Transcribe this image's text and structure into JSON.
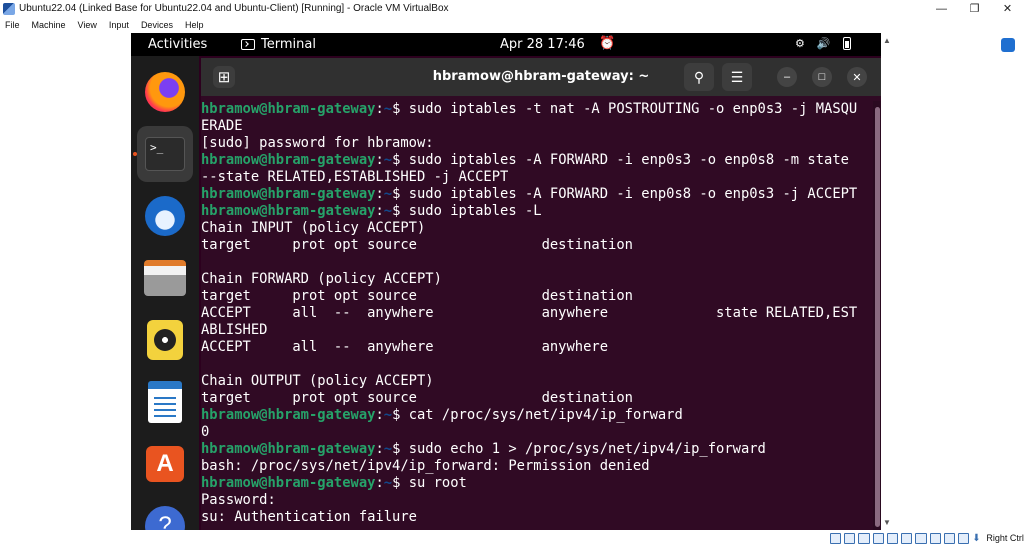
{
  "host": {
    "title": "Ubuntu22.04 (Linked Base for Ubuntu22.04 and Ubuntu-Client) [Running] - Oracle VM VirtualBox",
    "menu": [
      "File",
      "Machine",
      "View",
      "Input",
      "Devices",
      "Help"
    ],
    "window_buttons": [
      "minimize",
      "restore",
      "close"
    ],
    "status_right_label": "Right Ctrl"
  },
  "gnome": {
    "activities": "Activities",
    "app_name": "Terminal",
    "clock": "Apr 28  17:46"
  },
  "dock": {
    "apps": [
      {
        "name": "firefox-icon"
      },
      {
        "name": "terminal-icon",
        "glyph": ">_"
      },
      {
        "name": "thunderbird-icon"
      },
      {
        "name": "files-icon"
      },
      {
        "name": "rhythmbox-icon"
      },
      {
        "name": "libreoffice-writer-icon"
      },
      {
        "name": "app-center-icon",
        "glyph": "A"
      },
      {
        "name": "help-icon",
        "glyph": "?"
      }
    ]
  },
  "terminal": {
    "title": "hbramow@hbram-gateway: ~",
    "prompt_user": "hbramow@hbram-gateway",
    "prompt_sep": ":",
    "prompt_path": "~",
    "prompt_end": "$ ",
    "lines": [
      {
        "prompt": true,
        "text": "sudo iptables -t nat -A POSTROUTING -o enp0s3 -j MASQU"
      },
      {
        "prompt": false,
        "text": "ERADE"
      },
      {
        "prompt": false,
        "text": "[sudo] password for hbramow:"
      },
      {
        "prompt": true,
        "text": "sudo iptables -A FORWARD -i enp0s3 -o enp0s8 -m state"
      },
      {
        "prompt": false,
        "text": "--state RELATED,ESTABLISHED -j ACCEPT"
      },
      {
        "prompt": true,
        "text": "sudo iptables -A FORWARD -i enp0s8 -o enp0s3 -j ACCEPT"
      },
      {
        "prompt": true,
        "text": "sudo iptables -L"
      },
      {
        "prompt": false,
        "text": "Chain INPUT (policy ACCEPT)"
      },
      {
        "prompt": false,
        "text": "target     prot opt source               destination"
      },
      {
        "prompt": false,
        "text": ""
      },
      {
        "prompt": false,
        "text": "Chain FORWARD (policy ACCEPT)"
      },
      {
        "prompt": false,
        "text": "target     prot opt source               destination"
      },
      {
        "prompt": false,
        "text": "ACCEPT     all  --  anywhere             anywhere             state RELATED,EST"
      },
      {
        "prompt": false,
        "text": "ABLISHED"
      },
      {
        "prompt": false,
        "text": "ACCEPT     all  --  anywhere             anywhere"
      },
      {
        "prompt": false,
        "text": ""
      },
      {
        "prompt": false,
        "text": "Chain OUTPUT (policy ACCEPT)"
      },
      {
        "prompt": false,
        "text": "target     prot opt source               destination"
      },
      {
        "prompt": true,
        "text": "cat /proc/sys/net/ipv4/ip_forward"
      },
      {
        "prompt": false,
        "text": "0"
      },
      {
        "prompt": true,
        "text": "sudo echo 1 > /proc/sys/net/ipv4/ip_forward"
      },
      {
        "prompt": false,
        "text": "bash: /proc/sys/net/ipv4/ip_forward: Permission denied"
      },
      {
        "prompt": true,
        "text": "su root"
      },
      {
        "prompt": false,
        "text": "Password:"
      },
      {
        "prompt": false,
        "text": "su: Authentication failure"
      }
    ]
  },
  "colors": {
    "terminal_bg": "#300a24",
    "prompt_user": "#26a269",
    "prompt_path": "#12488b",
    "ubuntu_orange": "#e95420"
  }
}
